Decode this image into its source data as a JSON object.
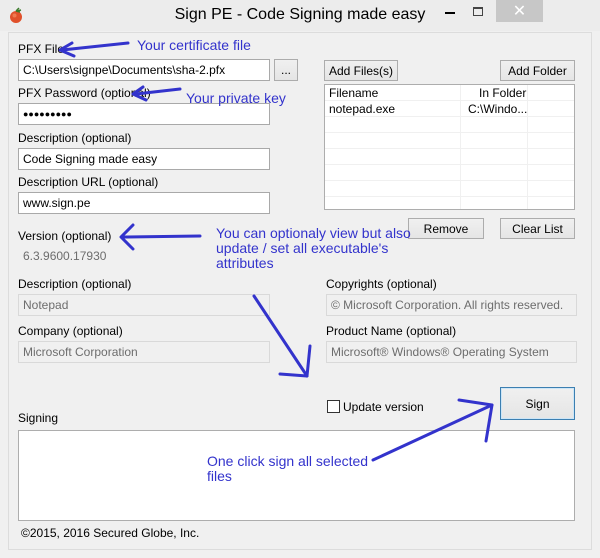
{
  "window": {
    "title": "Sign PE - Code Signing made easy",
    "controls": {
      "minimize": "–",
      "maximize": "☐",
      "close": "✕"
    }
  },
  "form": {
    "pfx_file": {
      "label": "PFX File",
      "value": "C:\\Users\\signpe\\Documents\\sha-2.pfx",
      "browse_label": "..."
    },
    "pfx_password": {
      "label": "PFX Password (optional)",
      "value": "●●●●●●●●●"
    },
    "description": {
      "label": "Description (optional)",
      "value": "Code Signing made easy"
    },
    "description_url": {
      "label": "Description URL (optional)",
      "value": "www.sign.pe"
    },
    "version": {
      "label": "Version (optional)",
      "value": "6.3.9600.17930"
    },
    "file_description": {
      "label": "Description (optional)",
      "value": "Notepad"
    },
    "company": {
      "label": "Company (optional)",
      "value": "Microsoft Corporation"
    },
    "copyrights": {
      "label": "Copyrights (optional)",
      "value": "© Microsoft Corporation. All rights reserved."
    },
    "product_name": {
      "label": "Product Name (optional)",
      "value": "Microsoft® Windows® Operating System"
    }
  },
  "files": {
    "add_files_label": "Add Files(s)",
    "add_folder_label": "Add Folder",
    "remove_label": "Remove",
    "clear_list_label": "Clear List",
    "columns": [
      "Filename",
      "In Folder"
    ],
    "rows": [
      {
        "filename": "notepad.exe",
        "folder": "C:\\Windo..."
      }
    ]
  },
  "update_version": {
    "label": "Update version",
    "checked": false
  },
  "sign_label": "Sign",
  "signing": {
    "label": "Signing",
    "log": ""
  },
  "footer": {
    "copyright": "©2015, 2016 Secured Globe, Inc."
  },
  "annotations": {
    "certificate": "Your certificate file",
    "private_key": "Your private key",
    "attributes": [
      "You can optionaly view but also",
      "update / set all executable's",
      "attributes"
    ],
    "sign": [
      "One click sign all selected",
      "files"
    ],
    "color": "#3333cc"
  }
}
